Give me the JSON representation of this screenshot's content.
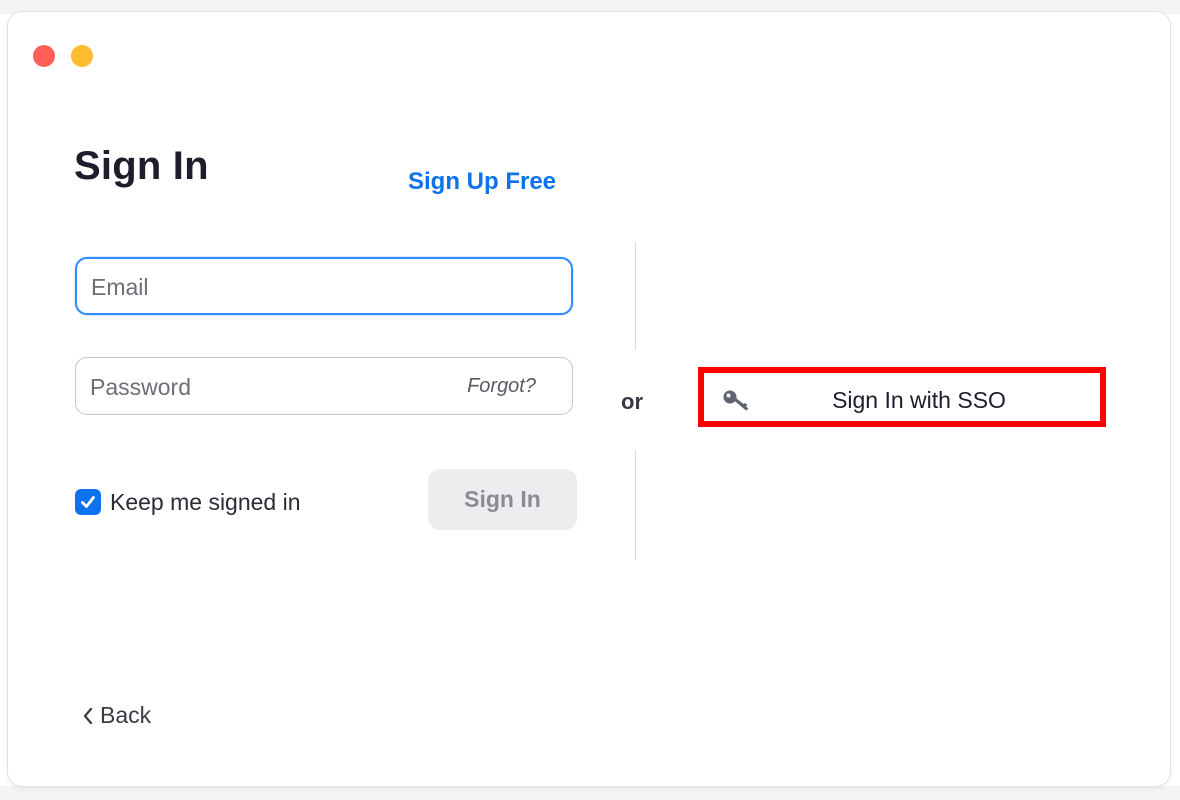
{
  "window": {
    "close_color": "#ff5f57",
    "minimize_color": "#febc2e"
  },
  "header": {
    "title": "Sign In",
    "signup_label": "Sign Up Free"
  },
  "form": {
    "email_placeholder": "Email",
    "password_placeholder": "Password",
    "forgot_label": "Forgot?",
    "keep_signed_in_label": "Keep me signed in",
    "keep_signed_in_checked": true,
    "signin_label": "Sign In"
  },
  "separator": {
    "or_label": "or"
  },
  "sso": {
    "label": "Sign In with SSO",
    "icon": "key-icon",
    "highlight_color": "#ff0000"
  },
  "footer": {
    "back_label": "Back",
    "back_icon": "chevron-left-icon"
  },
  "colors": {
    "accent": "#0e72ed",
    "focus_border": "#2d8cff"
  }
}
